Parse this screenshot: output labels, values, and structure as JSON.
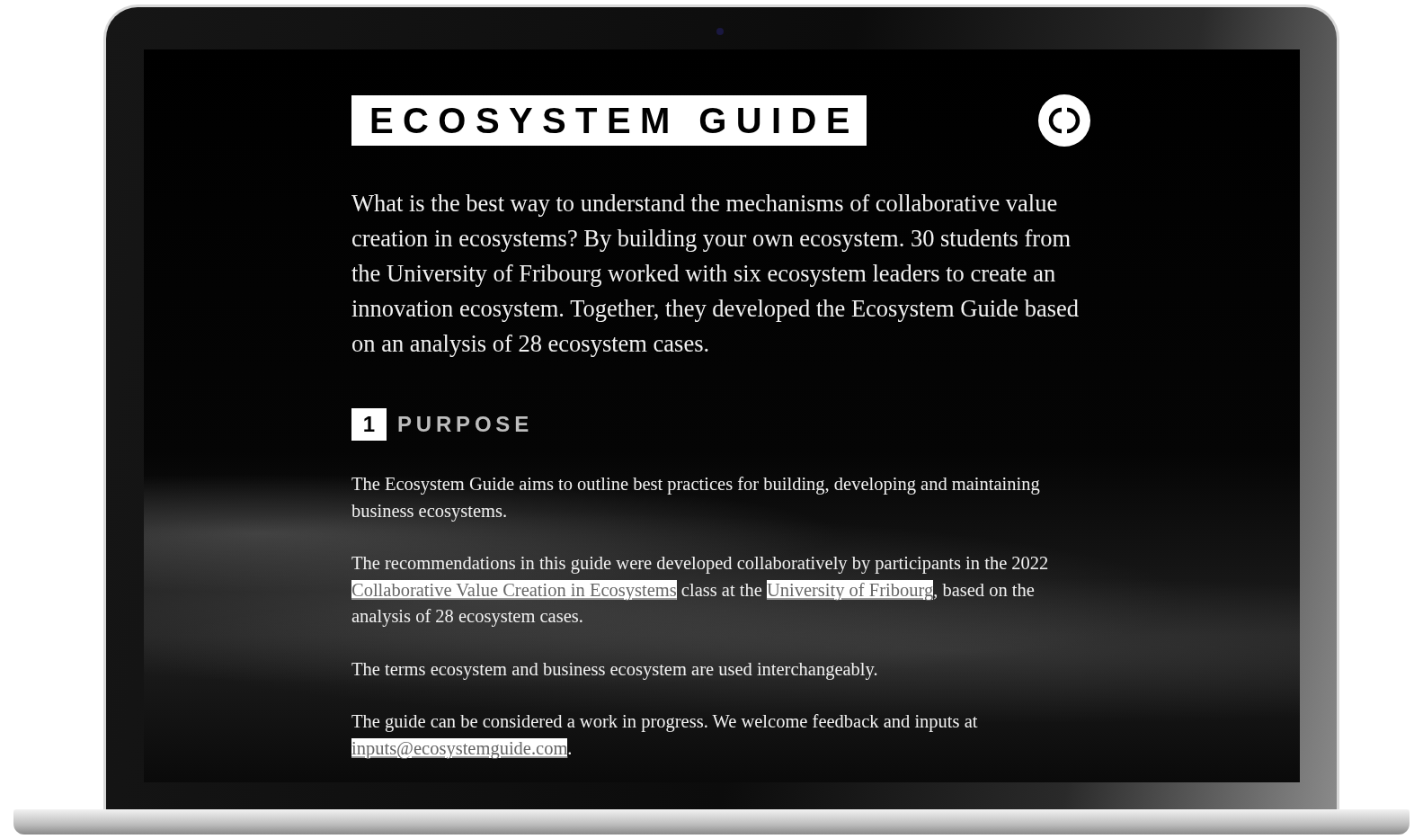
{
  "header": {
    "title": "ECOSYSTEM GUIDE"
  },
  "intro": "What is the best way to understand the mechanisms of collaborative value creation in ecosystems? By building your own ecosystem. 30 students from the University of Fribourg worked with six ecosystem leaders to create an innovation ecosystem. Together, they developed the Ecosystem Guide based on an analysis of 28 ecosystem cases.",
  "section": {
    "number": "1",
    "title": "PURPOSE"
  },
  "paragraphs": [
    {
      "segments": [
        {
          "text": "The Ecosystem Guide aims to outline best practices for building, developing and maintaining business ecosystems.",
          "link": false
        }
      ]
    },
    {
      "segments": [
        {
          "text": "The recommendations in this guide were developed collaboratively by participants in the 2022 ",
          "link": false
        },
        {
          "text": "Collaborative Value Creation in Ecosystems",
          "link": true
        },
        {
          "text": " class at the ",
          "link": false
        },
        {
          "text": "University of Fribourg",
          "link": true
        },
        {
          "text": ", based on the analysis of 28 ecosystem cases.",
          "link": false
        }
      ]
    },
    {
      "segments": [
        {
          "text": "The terms ecosystem and business ecosystem are used interchangeably.",
          "link": false
        }
      ]
    },
    {
      "segments": [
        {
          "text": "The guide can be considered a work in progress. We welcome feedback and inputs at ",
          "link": false
        },
        {
          "text": "inputs@ecosystemguide.com",
          "link": true
        },
        {
          "text": ".",
          "link": false
        }
      ]
    }
  ]
}
